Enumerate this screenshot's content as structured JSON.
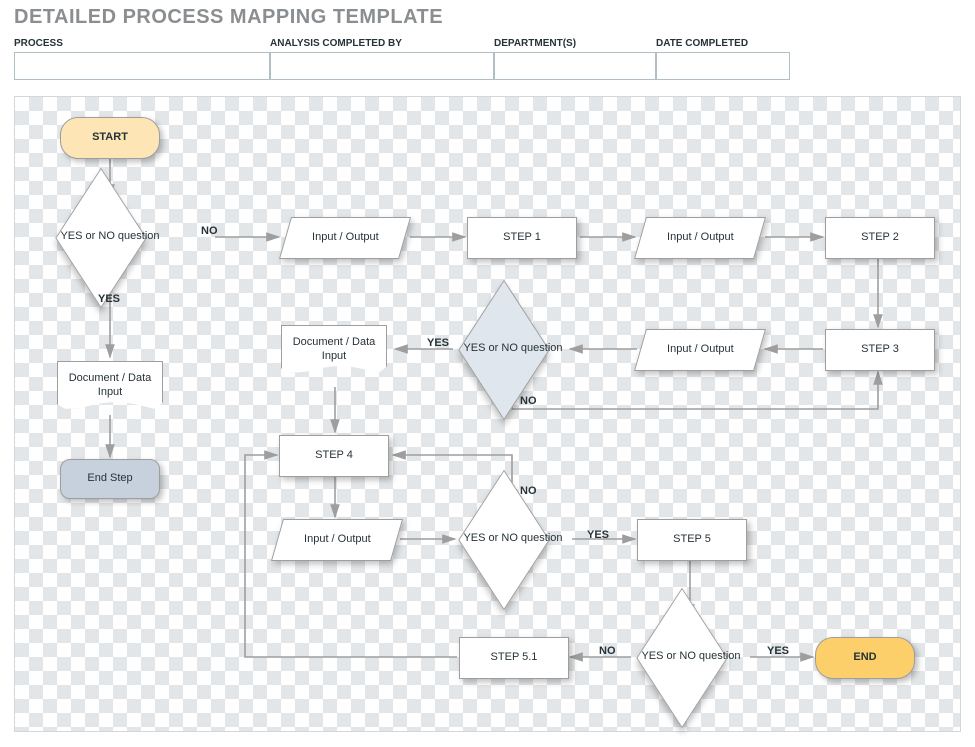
{
  "title": "DETAILED PROCESS MAPPING TEMPLATE",
  "header": {
    "process_label": "PROCESS",
    "analysis_label": "ANALYSIS COMPLETED BY",
    "department_label": "DEPARTMENT(S)",
    "date_label": "DATE COMPLETED",
    "process_value": "",
    "analysis_value": "",
    "department_value": "",
    "date_value": ""
  },
  "colors": {
    "start_fill": "#fde5b6",
    "end_fill": "#fccf6a",
    "endstep_fill": "#c7d1de",
    "decision_grey": "#dfe6ee",
    "arrow": "#9e9e9e"
  },
  "flow": {
    "start": "START",
    "end": "END",
    "end_step": "End Step",
    "decision": "YES or NO question",
    "doc_input": "Document / Data Input",
    "io": "Input / Output",
    "steps": {
      "s1": "STEP 1",
      "s2": "STEP 2",
      "s3": "STEP 3",
      "s4": "STEP 4",
      "s5": "STEP 5",
      "s51": "STEP 5.1"
    },
    "labels": {
      "yes": "YES",
      "no": "NO"
    }
  }
}
